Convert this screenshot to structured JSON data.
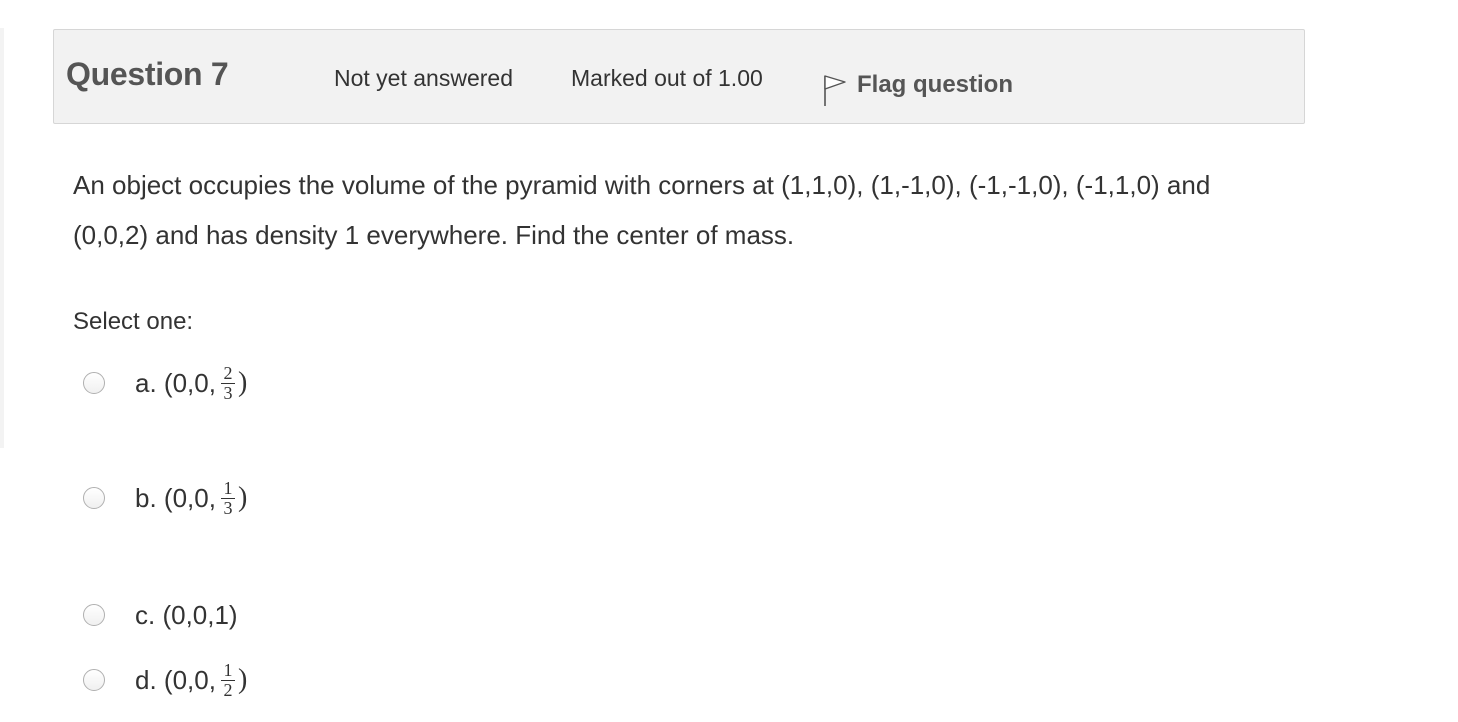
{
  "question": {
    "number_label": "Question 7",
    "state": "Not yet answered",
    "grade": "Marked out of 1.00",
    "flag_label": "Flag question",
    "text": "An object occupies the volume of the pyramid with corners at (1,1,0), (1,-1,0), (-1,-1,0), (-1,1,0) and (0,0,2) and has density 1 everywhere. Find the center of mass.",
    "prompt": "Select one:"
  },
  "options": {
    "a": {
      "prefix": "a. (0,0,",
      "numerator": "2",
      "denominator": "3",
      "suffix": ")"
    },
    "b": {
      "prefix": "b. (0,0,",
      "numerator": "1",
      "denominator": "3",
      "suffix": ")"
    },
    "c": {
      "text": "c. (0,0,1)"
    },
    "d": {
      "prefix": "d. (0,0,",
      "numerator": "1",
      "denominator": "2",
      "suffix": ")"
    }
  },
  "icons": {
    "flag": "flag-outline-icon",
    "radio": "radio-unchecked-icon"
  },
  "colors": {
    "info_bg": "#f2f2f2",
    "info_border": "#d6d6d6",
    "heading": "#555555",
    "text": "#333333"
  }
}
